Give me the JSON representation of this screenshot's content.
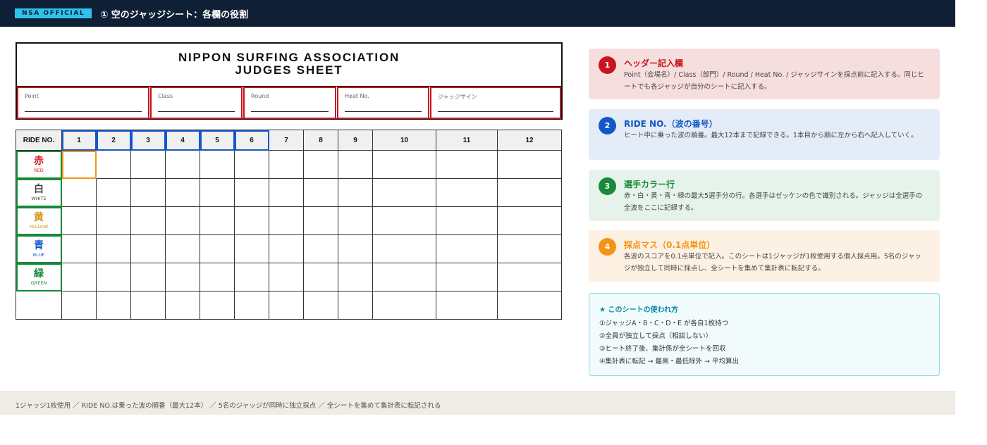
{
  "header": {
    "badge": "NSA OFFICIAL",
    "title": "① 空のジャッジシート：各欄の役割"
  },
  "sheet": {
    "title_line1": "NIPPON SURFING ASSOCIATION",
    "title_line2": "JUDGES SHEET",
    "fields": [
      "Point",
      "Class",
      "Round",
      "Heat No.",
      "ジャッジサイン"
    ],
    "ride_header": "RIDE NO.",
    "ride_numbers": [
      "1",
      "2",
      "3",
      "4",
      "5",
      "6",
      "7",
      "8",
      "9",
      "10",
      "11",
      "12"
    ],
    "rows": [
      {
        "kanji": "赤",
        "english": "RED",
        "color": "#d2141e"
      },
      {
        "kanji": "白",
        "english": "WHITE",
        "color": "#444444"
      },
      {
        "kanji": "黄",
        "english": "YELLOW",
        "color": "#d4940a"
      },
      {
        "kanji": "青",
        "english": "BLUE",
        "color": "#1458c8"
      },
      {
        "kanji": "緑",
        "english": "GREEN",
        "color": "#168a3a"
      }
    ]
  },
  "cards": [
    {
      "num": "1",
      "title": "ヘッダー記入欄",
      "body": "Point（会場名）/ Class（部門）/ Round / Heat No. / ジャッジサインを採点前に記入する。同じヒートでも各ジャッジが自分のシートに記入する。",
      "accent": "#c8141e",
      "bg": "#f6dede"
    },
    {
      "num": "2",
      "title": "RIDE NO.（波の番号）",
      "body": "ヒート中に乗った波の順番。最大12本まで記録できる。1本目から順に左から右へ記入していく。",
      "accent": "#1458c8",
      "bg": "#e4ecf7"
    },
    {
      "num": "3",
      "title": "選手カラー行",
      "body": "赤・白・黄・青・緑の最大5選手分の行。各選手はゼッケンの色で識別される。ジャッジは全選手の全波をここに記録する。",
      "accent": "#168a3a",
      "bg": "#e6f3ea"
    },
    {
      "num": "4",
      "title": "採点マス（0.1点単位）",
      "body": "各波のスコアを0.1点単位で記入。このシートは1ジャッジが1枚使用する個人採点用。5名のジャッジが独立して同時に採点し、全シートを集めて集計表に転記する。",
      "accent": "#f39414",
      "bg": "#fdf1e3"
    }
  ],
  "usage": {
    "title": "★ このシートの使われ方",
    "lines": [
      "①ジャッジA・B・C・D・E が各自1枚持つ",
      "②全員が独立して採点（相談しない）",
      "③ヒート終了後、集計係が全シートを回収",
      "④集計表に転記 → 最高・最低除外 → 平均算出"
    ]
  },
  "footer": {
    "text": "1ジャッジ1枚使用 ／ RIDE NO.は乗った波の順番（最大12本） ／ 5名のジャッジが同時に独立採点 ／ 全シートを集めて集計表に転記される"
  }
}
